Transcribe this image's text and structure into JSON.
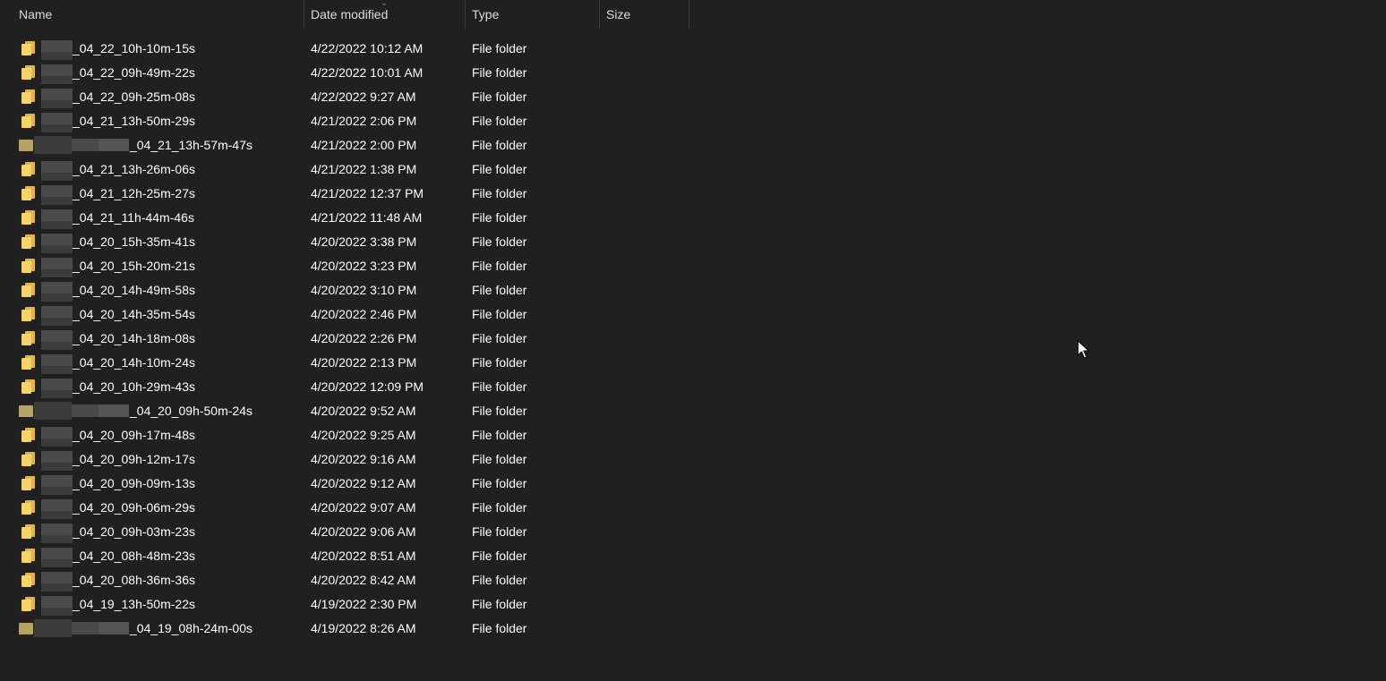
{
  "header": {
    "name": "Name",
    "date_modified": "Date modified",
    "type": "Type",
    "size": "Size",
    "sort_indicator": "⌄"
  },
  "rows": [
    {
      "name": "_04_22_10h-10m-15s",
      "date": "4/22/2022 10:12 AM",
      "type": "File folder",
      "wide": false
    },
    {
      "name": "_04_22_09h-49m-22s",
      "date": "4/22/2022 10:01 AM",
      "type": "File folder",
      "wide": false
    },
    {
      "name": "_04_22_09h-25m-08s",
      "date": "4/22/2022 9:27 AM",
      "type": "File folder",
      "wide": false
    },
    {
      "name": "_04_21_13h-50m-29s",
      "date": "4/21/2022 2:06 PM",
      "type": "File folder",
      "wide": false
    },
    {
      "name": "_04_21_13h-57m-47s",
      "date": "4/21/2022 2:00 PM",
      "type": "File folder",
      "wide": true
    },
    {
      "name": "_04_21_13h-26m-06s",
      "date": "4/21/2022 1:38 PM",
      "type": "File folder",
      "wide": false
    },
    {
      "name": "_04_21_12h-25m-27s",
      "date": "4/21/2022 12:37 PM",
      "type": "File folder",
      "wide": false
    },
    {
      "name": "_04_21_11h-44m-46s",
      "date": "4/21/2022 11:48 AM",
      "type": "File folder",
      "wide": false
    },
    {
      "name": "_04_20_15h-35m-41s",
      "date": "4/20/2022 3:38 PM",
      "type": "File folder",
      "wide": false
    },
    {
      "name": "_04_20_15h-20m-21s",
      "date": "4/20/2022 3:23 PM",
      "type": "File folder",
      "wide": false
    },
    {
      "name": "_04_20_14h-49m-58s",
      "date": "4/20/2022 3:10 PM",
      "type": "File folder",
      "wide": false
    },
    {
      "name": "_04_20_14h-35m-54s",
      "date": "4/20/2022 2:46 PM",
      "type": "File folder",
      "wide": false
    },
    {
      "name": "_04_20_14h-18m-08s",
      "date": "4/20/2022 2:26 PM",
      "type": "File folder",
      "wide": false
    },
    {
      "name": "_04_20_14h-10m-24s",
      "date": "4/20/2022 2:13 PM",
      "type": "File folder",
      "wide": false
    },
    {
      "name": "_04_20_10h-29m-43s",
      "date": "4/20/2022 12:09 PM",
      "type": "File folder",
      "wide": false
    },
    {
      "name": "_04_20_09h-50m-24s",
      "date": "4/20/2022 9:52 AM",
      "type": "File folder",
      "wide": true
    },
    {
      "name": "_04_20_09h-17m-48s",
      "date": "4/20/2022 9:25 AM",
      "type": "File folder",
      "wide": false
    },
    {
      "name": "_04_20_09h-12m-17s",
      "date": "4/20/2022 9:16 AM",
      "type": "File folder",
      "wide": false
    },
    {
      "name": "_04_20_09h-09m-13s",
      "date": "4/20/2022 9:12 AM",
      "type": "File folder",
      "wide": false
    },
    {
      "name": "_04_20_09h-06m-29s",
      "date": "4/20/2022 9:07 AM",
      "type": "File folder",
      "wide": false
    },
    {
      "name": "_04_20_09h-03m-23s",
      "date": "4/20/2022 9:06 AM",
      "type": "File folder",
      "wide": false
    },
    {
      "name": "_04_20_08h-48m-23s",
      "date": "4/20/2022 8:51 AM",
      "type": "File folder",
      "wide": false
    },
    {
      "name": "_04_20_08h-36m-36s",
      "date": "4/20/2022 8:42 AM",
      "type": "File folder",
      "wide": false
    },
    {
      "name": "_04_19_13h-50m-22s",
      "date": "4/19/2022 2:30 PM",
      "type": "File folder",
      "wide": false
    },
    {
      "name": "_04_19_08h-24m-00s",
      "date": "4/19/2022 8:26 AM",
      "type": "File folder",
      "wide": true
    }
  ],
  "icons": {
    "folder": "folder-icon",
    "cursor": "mouse-pointer-icon"
  }
}
